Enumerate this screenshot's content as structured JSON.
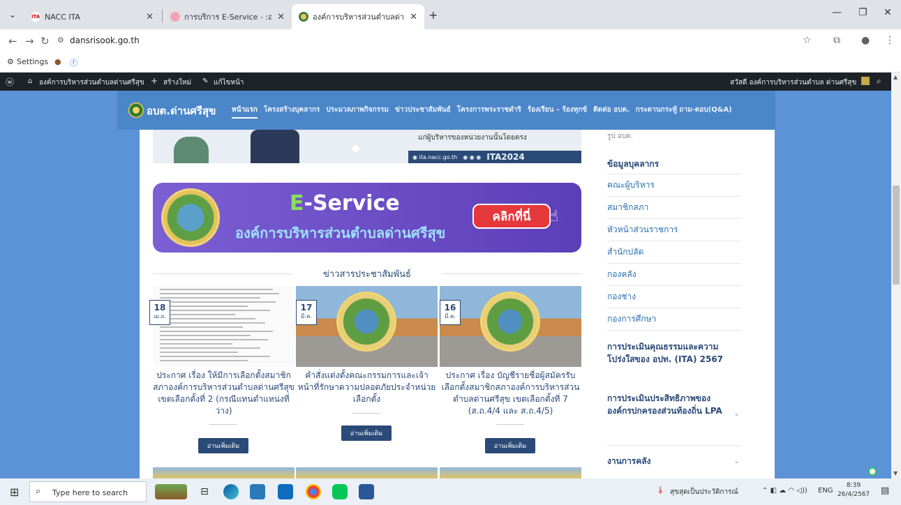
{
  "browser": {
    "tabs": [
      {
        "title": "NACC ITA",
        "active": false
      },
      {
        "title": "การบริการ E-Service - :อบต.โคกคร",
        "active": false
      },
      {
        "title": "องค์การบริหารส่วนตำบลด่านศรีสุข -",
        "active": true
      }
    ],
    "url": "dansrisook.go.th",
    "bookmarks": [
      "Settings"
    ]
  },
  "wp_admin_bar": {
    "site_name": "องค์การบริหารส่วนตำบลด่านศรีสุข",
    "new_label": "สร้างใหม่",
    "edit_label": "แก้ไขหน้า",
    "greeting": "สวัสดี องค์การบริหารส่วนตำบล ด่านศรีสุข"
  },
  "site": {
    "logo_text": "อบต.ด่านศรีสุข",
    "menu": [
      {
        "label": "หน้าแรก",
        "active": true
      },
      {
        "label": "โครงสร้างบุคลากร",
        "active": false
      },
      {
        "label": "ประมวลภาพกิจกรรม",
        "active": false
      },
      {
        "label": "ข่าวประชาสัมพันธ์",
        "active": false
      },
      {
        "label": "โครงการพระราชดำริ",
        "active": false
      },
      {
        "label": "ร้องเรียน – ร้องทุกข์",
        "active": false
      },
      {
        "label": "ติดต่อ อบต.",
        "active": false
      },
      {
        "label": "กระดานกระทู้ ถาม-ตอบ(Q&A)",
        "active": false
      }
    ]
  },
  "hero": {
    "text": "แก่ผู้บริหารของหน่วยงานนั้นโดยตรง",
    "badge": "ITA2024"
  },
  "eservice": {
    "title_e": "E",
    "title_rest": "-Service",
    "subtitle": "องค์การบริหารส่วนตำบลด่านศรีสุข",
    "button": "คลิกที่นี่"
  },
  "news": {
    "section_title": "ข่าวสารประชาสัมพันธ์",
    "items": [
      {
        "day": "18",
        "month": "เม.ย.",
        "title": "ประกาศ เรื่อง ให้มีการเลือกตั้งสมาชิกสภาองค์การบริหารส่วนตำบลด่านศรีสุข เขตเลือกตั้งที่ 2 (กรณีแทนตำแหน่งที่ว่าง)",
        "more": "อ่านเพิ่มเติม"
      },
      {
        "day": "17",
        "month": "มี.ค.",
        "title": "คำสั่งแต่งตั้งคณะกรรมการและเจ้าหน้าที่รักษาความปลอดภัยประจำหน่วยเลือกตั้ง",
        "more": "อ่านเพิ่มเติม"
      },
      {
        "day": "16",
        "month": "มี.ค.",
        "title": "ประกาศ เรื่อง บัญชีรายชื่อผู้สมัครรับเลือกตั้งสมาชิกสภาองค์การบริหารส่วนตำบลด่านศรีสุข เขตเลือกตั้งที่ 7 (ส.ถ.4/4 และ ส.ถ.4/5)",
        "more": "อ่านเพิ่มเติม"
      }
    ]
  },
  "sidebar": {
    "top_link": "รูป อบต.",
    "personnel_heading": "ข้อมูลบุคลากร",
    "personnel_items": [
      "คณะผู้บริหาร",
      "สมาชิกสภา",
      "หัวหน้าส่วนราชการ",
      "สำนักปลัด",
      "กองคลัง",
      "กองช่าง",
      "กองการศึกษา"
    ],
    "ita_heading": "การประเมินคุณธรรมและความโปร่งใสของ อปท. (ITA) 2567",
    "lpa_heading": "การประเมินประสิทธิภาพของ องค์กรปกครองส่วนท้องถิ่น LPA",
    "finance_heading": "งานการคลัง"
  },
  "taskbar": {
    "search_placeholder": "Type here to search",
    "notification": "สุขสุดเป็นประวัติการณ์",
    "language": "ENG",
    "time": "8:39",
    "date": "26/4/2567"
  }
}
